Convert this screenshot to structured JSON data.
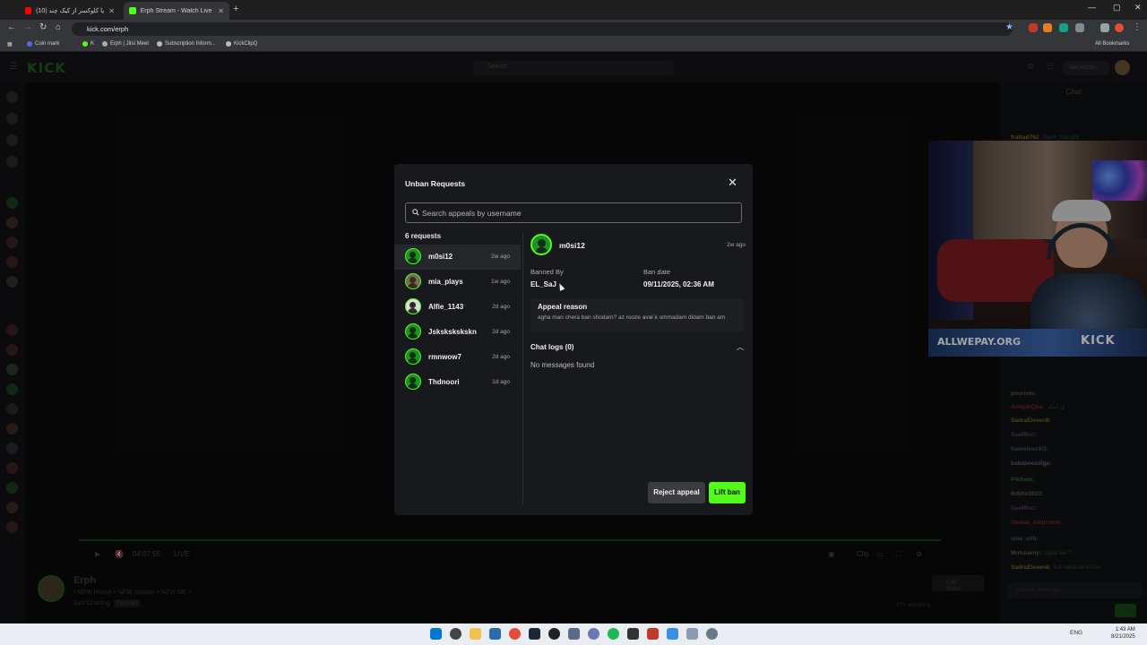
{
  "browser": {
    "tabs": [
      {
        "label": "(10) درامد آزیا کلوکسر از کیک چند"
      },
      {
        "label": "Erph Stream - Watch Live on Ki"
      }
    ],
    "url": "kick.com/erph",
    "bookmarks": [
      "Coin mark",
      "K",
      "Erph | Jitsi Meet",
      "Subscription Inform...",
      "KickClipQ"
    ],
    "all_bookmarks": "All Bookmarks"
  },
  "site": {
    "logo": "KICK",
    "search_placeholder": "Search",
    "get_kicks": "Get KICKs"
  },
  "player": {
    "time": "04:07:55",
    "live": "LIVE",
    "clip": "Clip"
  },
  "streamer": {
    "name": "Erph",
    "title": "• NEW House • NEW Season • NEW ME •",
    "category": "Just Chatting",
    "tag": "Persian",
    "gift_subs": "Gift Subs",
    "watching": "379 watching"
  },
  "chat": {
    "header": "Chat",
    "lines": [
      {
        "user": "frafrad762",
        "msg": "Aleph_Naught",
        "color": "#7a6a2a"
      },
      {
        "user": "bababeesdlge:",
        "msg": "",
        "color": "#6a5a8a"
      },
      {
        "user": "Aeeshvpala:",
        "msg": "کسی آنی شد",
        "color": "#7a2a2a"
      },
      {
        "user": "poorism:",
        "msg": "",
        "color": "#5a5a5a"
      },
      {
        "user": "AnhydrQka:",
        "msg": "ی اینکه",
        "color": "#7a2a2a"
      },
      {
        "user": "SadraEleven8:",
        "msg": "",
        "color": "#7a6a2a"
      },
      {
        "user": "SaaMhic:",
        "msg": "",
        "color": "#5a3a6a"
      },
      {
        "user": "NamelessXO:",
        "msg": "",
        "color": "#3a5a6a"
      },
      {
        "user": "bababeesdlge:",
        "msg": "",
        "color": "#6a5a8a"
      },
      {
        "user": "P4rham:",
        "msg": "",
        "color": "#3a6a3a"
      },
      {
        "user": "8r8ifio2033:",
        "msg": "",
        "color": "#5a5a5a"
      },
      {
        "user": "SaaMhic:",
        "msg": "",
        "color": "#5a3a6a"
      },
      {
        "user": "Shaian_emprnmw:",
        "msg": "",
        "color": "#7a2a2a"
      },
      {
        "user": "sina_srib:",
        "msg": "",
        "color": "#3a5a6a"
      },
      {
        "user": "Mohsaeny:",
        "msg": "sajad kie ?",
        "color": "#5a5a5a"
      },
      {
        "user": "SadraEleven8:",
        "msg": "hal nakarde bahar",
        "color": "#7a6a2a"
      }
    ],
    "input_placeholder": "Send a message",
    "send_label": "Chat"
  },
  "webcam": {
    "banner_text": "ALLWEPAY.ORG",
    "banner_brand": "KICK"
  },
  "modal": {
    "title": "Unban Requests",
    "search_placeholder": "Search appeals by username",
    "count_label": "6 requests",
    "requests": [
      {
        "name": "m0si12",
        "time": "2w ago"
      },
      {
        "name": "mia_plays",
        "time": "1w ago"
      },
      {
        "name": "Alfie_1143",
        "time": "2d ago"
      },
      {
        "name": "Jskskskskskn",
        "time": "2d ago"
      },
      {
        "name": "rmnwow7",
        "time": "2d ago"
      },
      {
        "name": "Thdnoori",
        "time": "1d ago"
      }
    ],
    "detail": {
      "name": "m0si12",
      "time": "2w ago",
      "banned_by_label": "Banned By",
      "banned_by": "EL_SaJ",
      "ban_date_label": "Ban date",
      "ban_date": "09/11/2025, 02:36 AM",
      "appeal_reason_label": "Appeal reason",
      "appeal_reason": "agha man chera ban shodam? az rooze aval k ommadam didam ban am",
      "chat_logs_label": "Chat logs (0)",
      "no_messages": "No messages found"
    },
    "reject_label": "Reject appeal",
    "lift_label": "Lift ban"
  },
  "taskbar": {
    "lang": "ENG",
    "time": "1:43 AM",
    "date": "8/21/2025"
  }
}
